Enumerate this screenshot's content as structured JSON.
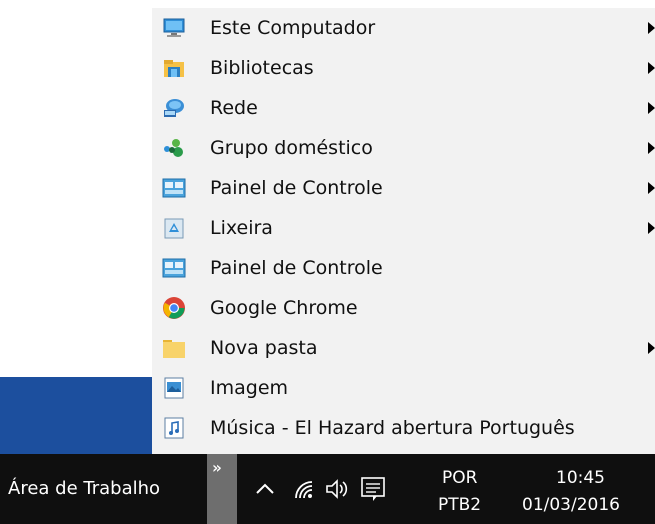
{
  "menu": {
    "items": [
      {
        "label": "Este Computador",
        "icon": "computer-icon",
        "has_submenu": true
      },
      {
        "label": "Bibliotecas",
        "icon": "libraries-icon",
        "has_submenu": true
      },
      {
        "label": "Rede",
        "icon": "network-icon",
        "has_submenu": true
      },
      {
        "label": "Grupo doméstico",
        "icon": "homegroup-icon",
        "has_submenu": true
      },
      {
        "label": "Painel de Controle",
        "icon": "control-panel-icon",
        "has_submenu": true
      },
      {
        "label": "Lixeira",
        "icon": "recycle-bin-icon",
        "has_submenu": true
      },
      {
        "label": "Painel de Controle",
        "icon": "control-panel-icon",
        "has_submenu": false
      },
      {
        "label": "Google Chrome",
        "icon": "chrome-icon",
        "has_submenu": false
      },
      {
        "label": "Nova pasta",
        "icon": "folder-icon",
        "has_submenu": true
      },
      {
        "label": "Imagem",
        "icon": "image-file-icon",
        "has_submenu": false
      },
      {
        "label": "Música - El Hazard abertura Português",
        "icon": "music-file-icon",
        "has_submenu": false
      }
    ]
  },
  "taskbar": {
    "toolbar_label": "Área de Trabalho",
    "overflow_glyph": "»",
    "language_line1": "POR",
    "language_line2": "PTB2",
    "time": "10:45",
    "date": "01/03/2016",
    "tray_icons": [
      "chevron-up-icon",
      "wifi-icon",
      "volume-icon",
      "action-center-icon"
    ]
  },
  "colors": {
    "taskbar_bg": "#0f0f0f",
    "menu_bg": "#f2f2f2",
    "accent_blue": "#1c4f9e"
  }
}
